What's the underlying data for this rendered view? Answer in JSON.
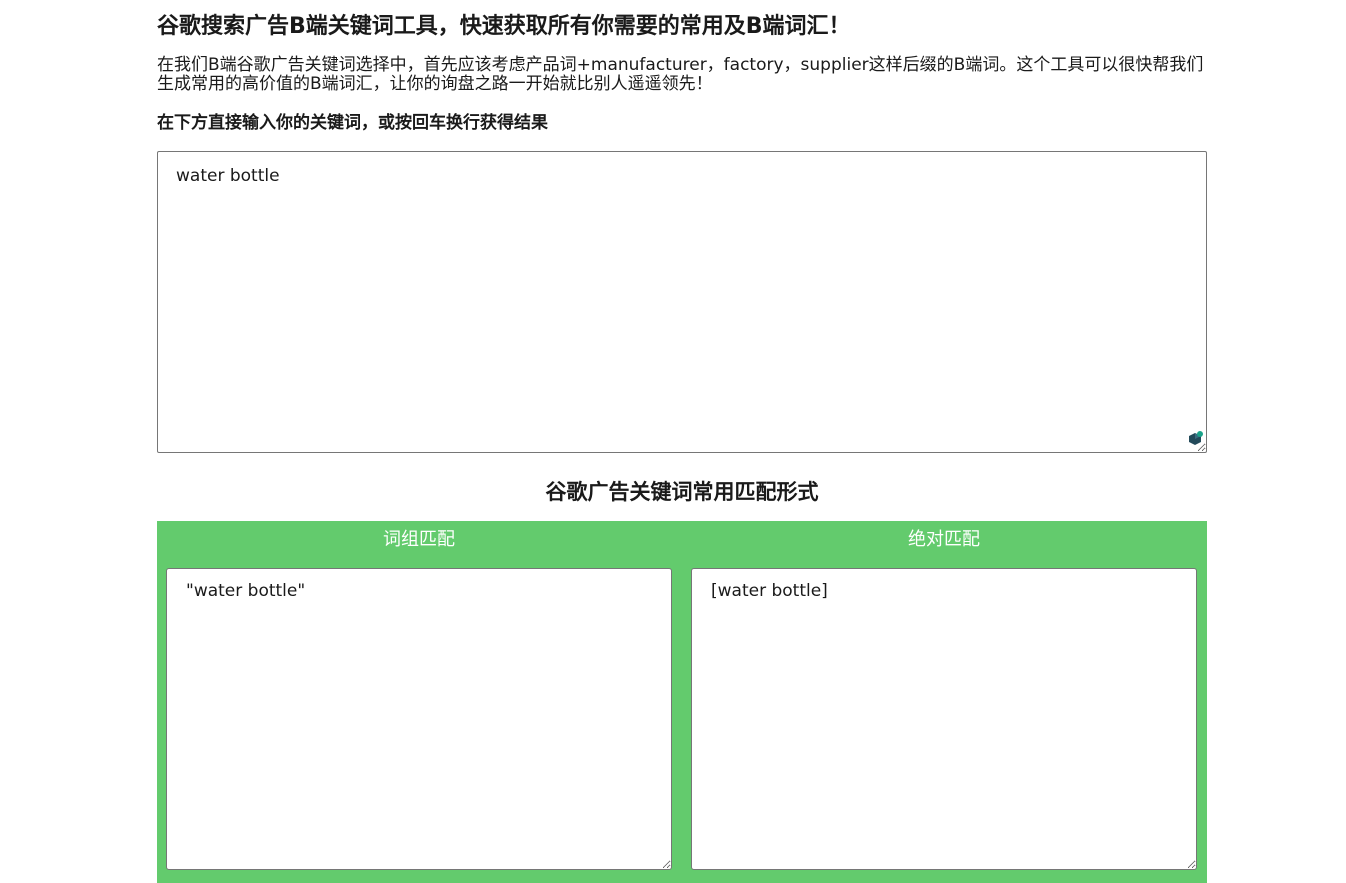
{
  "header": {
    "title": "谷歌搜索广告B端关键词工具，快速获取所有你需要的常用及B端词汇！",
    "intro": "在我们B端谷歌广告关键词选择中，首先应该考虑产品词+manufacturer，factory，supplier这样后缀的B端词。这个工具可以很快帮我们生成常用的高价值的B端词汇，让你的询盘之路一开始就比别人遥遥领先！",
    "instruction": "在下方直接输入你的关键词，或按回车换行获得结果"
  },
  "main_input": {
    "value": "water bottle",
    "extension_icon": "extension-puzzle-icon"
  },
  "match_section": {
    "title": "谷歌广告关键词常用匹配形式",
    "panel_color": "#63cb6d",
    "phrase": {
      "label": "词组匹配",
      "value": "\"water bottle\""
    },
    "exact": {
      "label": "绝对匹配",
      "value": "[water bottle]"
    }
  }
}
